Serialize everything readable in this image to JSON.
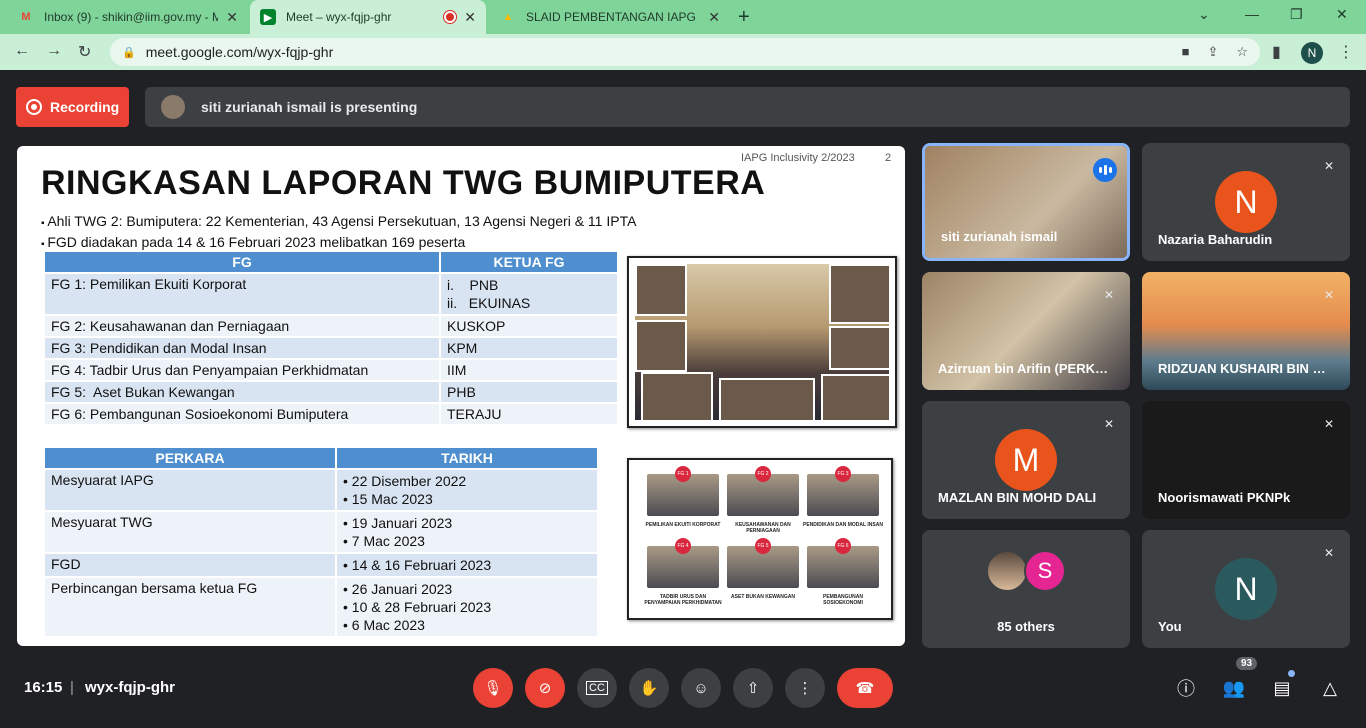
{
  "browser": {
    "tabs": [
      {
        "title": "Inbox (9) - shikin@iim.gov.my - M",
        "icon": "gmail-icon"
      },
      {
        "title": "Meet – wyx-fqjp-ghr",
        "icon": "meet-icon"
      },
      {
        "title": "SLAID PEMBENTANGAN IAPG BIL",
        "icon": "drive-icon"
      }
    ],
    "url": "meet.google.com/wyx-fqjp-ghr",
    "profile_initial": "N"
  },
  "meet": {
    "recording_label": "Recording",
    "presenting_text": "siti zurianah ismail is presenting",
    "clock": "16:15",
    "separator": "|",
    "meeting_code": "wyx-fqjp-ghr",
    "participants_count": "93"
  },
  "slide": {
    "tag": "IAPG Inclusivity 2/2023",
    "page_number": "2",
    "title": "RINGKASAN LAPORAN TWG BUMIPUTERA",
    "bullets": [
      "Ahli TWG 2: Bumiputera: 22 Kementerian, 43 Agensi Persekutuan, 13 Agensi Negeri & 11 IPTA",
      "FGD diadakan pada 14 & 16 Februari 2023 melibatkan 169 peserta"
    ],
    "table1": {
      "headers": [
        "FG",
        "KETUA FG"
      ],
      "rows": [
        {
          "fg": "FG 1: Pemilikan Ekuiti Korporat",
          "lead1": "i.    PNB",
          "lead2": "ii.   EKUINAS"
        },
        {
          "fg": "FG 2: Keusahawanan dan Perniagaan",
          "lead1": "KUSKOP"
        },
        {
          "fg": "FG 3: Pendidikan dan Modal Insan",
          "lead1": "KPM"
        },
        {
          "fg": "FG 4: Tadbir Urus dan Penyampaian Perkhidmatan",
          "lead1": "IIM"
        },
        {
          "fg": "FG 5:  Aset Bukan Kewangan",
          "lead1": "PHB"
        },
        {
          "fg": "FG 6: Pembangunan Sosioekonomi Bumiputera",
          "lead1": "TERAJU"
        }
      ]
    },
    "table2": {
      "headers": [
        "PERKARA",
        "TARIKH"
      ],
      "rows": [
        {
          "item": "Mesyuarat IAPG",
          "dates": [
            "22 Disember 2022",
            "15 Mac 2023"
          ]
        },
        {
          "item": "Mesyuarat TWG",
          "dates": [
            "19 Januari 2023",
            "7 Mac 2023"
          ]
        },
        {
          "item": "FGD",
          "dates": [
            "14 & 16 Februari 2023"
          ]
        },
        {
          "item": "Perbincangan bersama ketua FG",
          "dates": [
            "26 Januari 2023",
            "10 & 28 Februari 2023",
            "6 Mac 2023"
          ]
        }
      ]
    },
    "fg_photos": [
      {
        "badge": "FG 1",
        "caption": "PEMILIKAN EKUITI KORPORAT"
      },
      {
        "badge": "FG 2",
        "caption": "KEUSAHAWANAN DAN PERNIAGAAN"
      },
      {
        "badge": "FG 3",
        "caption": "PENDIDIKAN DAN MODAL INSAN"
      },
      {
        "badge": "FG 4",
        "caption": "TADBIR URUS DAN PENYAMPAIAN PERKHIDMATAN"
      },
      {
        "badge": "FG 5",
        "caption": "ASET BUKAN KEWANGAN"
      },
      {
        "badge": "FG 6",
        "caption": "PEMBANGUNAN SOSIOEKONOMI"
      }
    ]
  },
  "tiles": [
    {
      "name": "siti zurianah ismail"
    },
    {
      "name": "Nazaria Baharudin",
      "initial": "N",
      "color": "#e8541c"
    },
    {
      "name": "Azirruan bin Arifin (PERKESO)"
    },
    {
      "name": "RIDZUAN KUSHAIRI BIN MOHD"
    },
    {
      "name": "MAZLAN BIN MOHD DALI",
      "initial": "M",
      "color": "#e8541c"
    },
    {
      "name": "Noorismawati PKNPk"
    },
    {
      "name": "85 others",
      "initial": "S",
      "color": "#e52592"
    },
    {
      "name": "You",
      "initial": "N",
      "color": "#2b5a5e"
    }
  ]
}
